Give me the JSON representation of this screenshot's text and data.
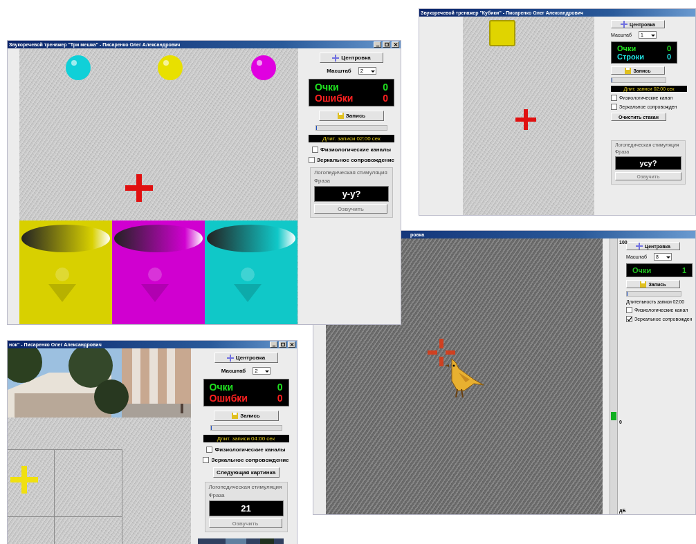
{
  "windows": [
    {
      "title": "Звукоречевой тренажер \"Три мешка\" - Писаренко Олег Александрович",
      "title_buttons": [
        {
          "kind": "minimize"
        },
        {
          "kind": "maximize"
        },
        {
          "kind": "close"
        }
      ],
      "game": {
        "kind": "three_bags",
        "balls": [
          {
            "color": "#10d0d8"
          },
          {
            "color": "#e8e000"
          },
          {
            "color": "#e000e0"
          }
        ],
        "cross": {
          "color": "#e01010"
        },
        "bins": [
          {
            "color": "#d8d000"
          },
          {
            "color": "#d000d0"
          },
          {
            "color": "#10c8c8"
          }
        ]
      },
      "panel": {
        "center_button": "Центровка",
        "scale_label": "Масштаб",
        "scale_value": "2",
        "scores": [
          {
            "label": "Очки",
            "value": "0",
            "color": "#20e020"
          },
          {
            "label": "Ошибки",
            "value": "0",
            "color": "#ff2020"
          }
        ],
        "record_button": "Запись",
        "progress": {
          "level": 0
        },
        "duration": {
          "kind": "bar",
          "text": "Длит. записи 02:00 сек"
        },
        "checkboxes": [
          {
            "label": "Физиологические каналы",
            "checked": false
          },
          {
            "label": "Зеркальное сопровождение",
            "checked": false
          }
        ],
        "group": {
          "title": "Логопедическая стимуляция",
          "phrase_label": "Фраза",
          "phrase": "у-у?",
          "speak_button": "Озвучить",
          "disabled": true
        }
      }
    },
    {
      "title": "Звукоречевой тренажер \"Кубики\" - Писаренко Олег Александрович",
      "game": {
        "kind": "cubes",
        "block": {
          "color": "#e0d400"
        },
        "cross": {
          "color": "#e01010"
        }
      },
      "panel": {
        "center_button": "Центровка",
        "scale_label": "Масштаб",
        "scale_value": "1",
        "scores": [
          {
            "label": "Очки",
            "value": "0",
            "color": "#20e020"
          },
          {
            "label": "Строки",
            "value": "0",
            "color": "#20e0e0"
          }
        ],
        "record_button": "Запись",
        "progress": {
          "level": 0
        },
        "duration": {
          "kind": "bar",
          "text": "Длит. записи 02:00 сек"
        },
        "checkboxes": [
          {
            "label": "Физиологические канал",
            "checked": false
          },
          {
            "label": "Зеркальное сопровожден",
            "checked": false
          }
        ],
        "extra_button": "Очистить стакан",
        "group": {
          "title": "Логопедическая стимуляция",
          "phrase_label": "Фраза",
          "phrase": "усу?",
          "speak_button": "Озвучить",
          "disabled": true
        }
      }
    },
    {
      "title": "нок\" - Писаренко Олег Александрович",
      "title_buttons": [
        {
          "kind": "minimize"
        },
        {
          "kind": "maximize"
        },
        {
          "kind": "close"
        }
      ],
      "game": {
        "kind": "pictures",
        "cross": {
          "color": "#f0e010"
        }
      },
      "panel": {
        "center_button": "Центровка",
        "scale_label": "Масштаб",
        "scale_value": "2",
        "scores": [
          {
            "label": "Очки",
            "value": "0",
            "color": "#20e020"
          },
          {
            "label": "Ошибки",
            "value": "0",
            "color": "#ff2020"
          }
        ],
        "record_button": "Запись",
        "progress": {
          "level": 0
        },
        "duration": {
          "kind": "bar",
          "text": "Длит. записи 04:00 сек"
        },
        "checkboxes": [
          {
            "label": "Физиологические каналы",
            "checked": false
          },
          {
            "label": "Зеркальное сопровождение",
            "checked": false
          }
        ],
        "extra_button": "Следующая картинка",
        "group": {
          "title": "Логопедическая стимуляция",
          "phrase_label": "Фраза",
          "phrase": "21",
          "speak_button": "Озвучить",
          "disabled": true
        }
      }
    },
    {
      "title": "ровка",
      "game": {
        "kind": "bird",
        "crosshair": {
          "color": "#d04020"
        }
      },
      "meter": {
        "top_label": "100",
        "zero_label": "0",
        "unit_label": "дБ",
        "level": 0.34
      },
      "panel": {
        "center_button": "Центровка",
        "scale_label": "Масштаб",
        "scale_value": "8",
        "scores": [
          {
            "label": "Очки",
            "value": "1",
            "color": "#20c020"
          }
        ],
        "record_button": "Запись",
        "progress": {
          "level": 0
        },
        "duration": {
          "kind": "plain",
          "text": "Длительность записи 02:00"
        },
        "checkboxes": [
          {
            "label": "Физиологические канал",
            "checked": false
          },
          {
            "label": "Зеркальное сопровожден",
            "checked": true
          }
        ]
      }
    }
  ]
}
